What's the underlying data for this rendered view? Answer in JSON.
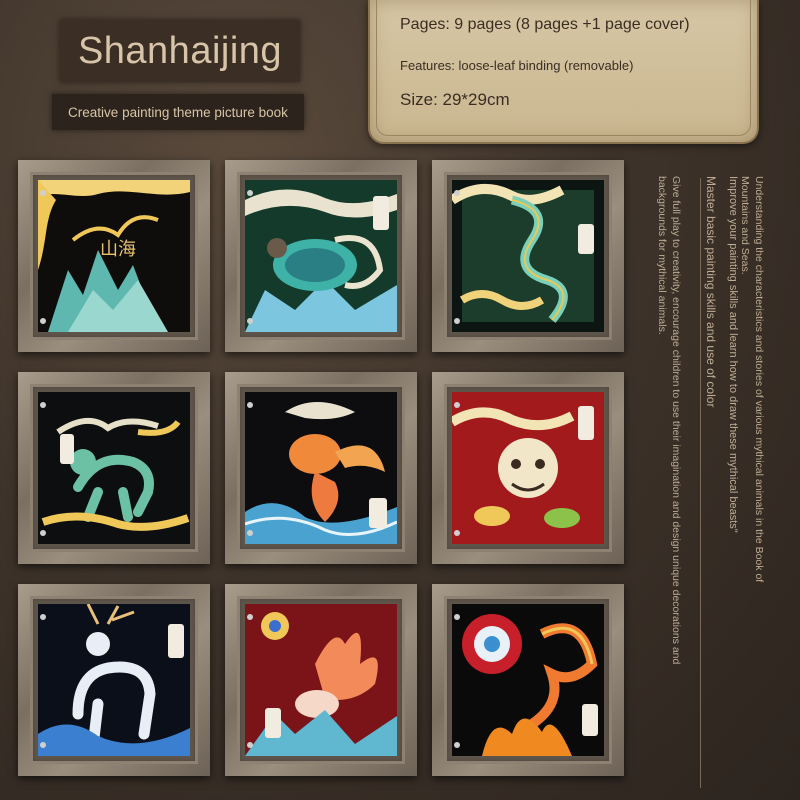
{
  "title": "Shanhaijing",
  "subtitle": "Creative painting theme picture book",
  "info": {
    "pages": "Pages: 9 pages (8 pages +1 page cover)",
    "features": "Features: loose-leaf binding (removable)",
    "size": "Size: 29*29cm"
  },
  "side_text": {
    "col1": "Understanding the characteristics and stories of various mythical animals in the Book of Mountains and Seas.",
    "col2": "Master basic painting skills and use of color",
    "col2b": "Improve your painting skills and learn how to draw these mythical beasts\"",
    "col3": "Give full play to creativity, encourage children to use their imagination and design unique decorations and backgrounds for mythical animals."
  },
  "pictures": [
    {
      "subject": "cover-mountains",
      "bg": "#0f0d0c",
      "accent": "#f0c85a"
    },
    {
      "subject": "black-tortoise",
      "bg": "#133a2a",
      "accent": "#3fb2a8"
    },
    {
      "subject": "azure-dragon",
      "bg": "#1c3c2c",
      "accent": "#7ad0b8"
    },
    {
      "subject": "qilin",
      "bg": "#0c0e0f",
      "accent": "#6cc0a4"
    },
    {
      "subject": "golden-fish",
      "bg": "#0d0d10",
      "accent": "#f08a3a"
    },
    {
      "subject": "pixiu",
      "bg": "#a31a1c",
      "accent": "#f2e6c8"
    },
    {
      "subject": "white-deer",
      "bg": "#0b0f1a",
      "accent": "#e8eef5"
    },
    {
      "subject": "nine-tailed-fox",
      "bg": "#7a1418",
      "accent": "#f28a5a"
    },
    {
      "subject": "phoenix",
      "bg": "#0a0a0a",
      "accent": "#f07a30"
    }
  ]
}
